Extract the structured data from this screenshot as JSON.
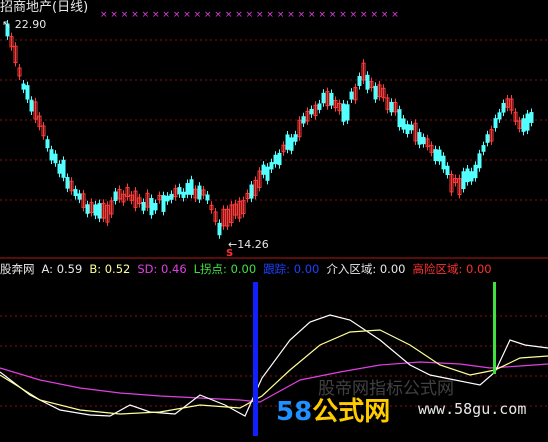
{
  "title": "招商地产(日线)",
  "price_high_label": "22.90",
  "price_low_label": "14.26",
  "sell_marker": "S",
  "indicator": {
    "name": "股奔网",
    "a": "A: 0.59",
    "b": "B: 0.52",
    "sd": "SD: 0.46",
    "l": "L拐点: 0.00",
    "jump": "跟踪: 0.00",
    "enter": "介入区域: 0.00",
    "risk": "高险区域: 0.00"
  },
  "watermark": {
    "brand_digits": "58",
    "brand_text": "公式网",
    "url": "www.58gu.com",
    "faint": "股帝网指标公式网"
  },
  "colors": {
    "up": "#ff3c3c",
    "down": "#54ffff",
    "grid": "#8a1010",
    "magenta": "#e040e0",
    "yellow": "#ffff99",
    "white": "#ffffff",
    "blue": "#1020ff",
    "green": "#40e040"
  }
}
